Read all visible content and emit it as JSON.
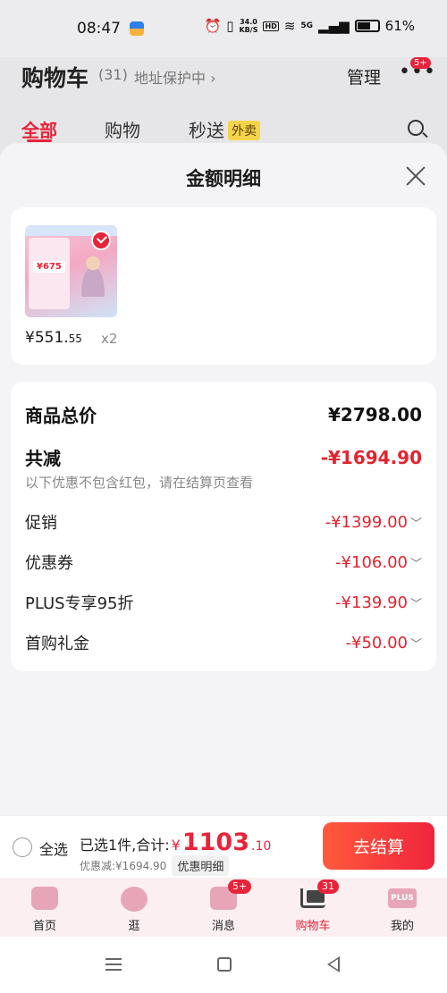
{
  "status_bar": {
    "time": "08:47",
    "net_speed_value": "34.0",
    "net_speed_unit": "KB/S",
    "hd": "HD",
    "signal": "5G",
    "battery": "61%"
  },
  "cart_header": {
    "title": "购物车",
    "count": "(31)",
    "address": "地址保护中 ›",
    "manage": "管理",
    "more_badge": "5+",
    "tabs": [
      {
        "label": "全部"
      },
      {
        "label": "购物"
      },
      {
        "label": "秒送"
      }
    ],
    "waimai_tag": "外卖"
  },
  "sheet": {
    "title": "金额明细"
  },
  "product": {
    "price_main": "¥551.",
    "price_dec": "55",
    "quantity": "x2",
    "image_text": "¥675"
  },
  "details": {
    "total_label": "商品总价",
    "total_value": "¥2798.00",
    "discount_label": "共减",
    "discount_value": "-¥1694.90",
    "note": "以下优惠不包含红包，请在结算页查看",
    "items": [
      {
        "label": "促销",
        "value": "-¥1399.00"
      },
      {
        "label": "优惠券",
        "value": "-¥106.00"
      },
      {
        "label": "PLUS专享95折",
        "value": "-¥139.90"
      },
      {
        "label": "首购礼金",
        "value": "-¥50.00"
      }
    ]
  },
  "checkout": {
    "select_all": "全选",
    "summary_prefix": "已选1件,合计:",
    "yen": "¥",
    "total_int": "1103",
    "total_dec": ".10",
    "saved": "优惠减:¥1694.90",
    "detail_chip": "优惠明细",
    "button": "去结算"
  },
  "tabbar": {
    "items": [
      {
        "label": "首页",
        "icon": "home-icon"
      },
      {
        "label": "逛",
        "icon": "browse-icon"
      },
      {
        "label": "消息",
        "icon": "message-icon",
        "badge": "5+"
      },
      {
        "label": "购物车",
        "icon": "cart-icon",
        "badge": "31"
      },
      {
        "label": "我的",
        "icon": "plus-icon",
        "icon_text": "PLUS"
      }
    ]
  },
  "colors": {
    "accent": "#e8243b",
    "price_red": "#e0252f"
  }
}
